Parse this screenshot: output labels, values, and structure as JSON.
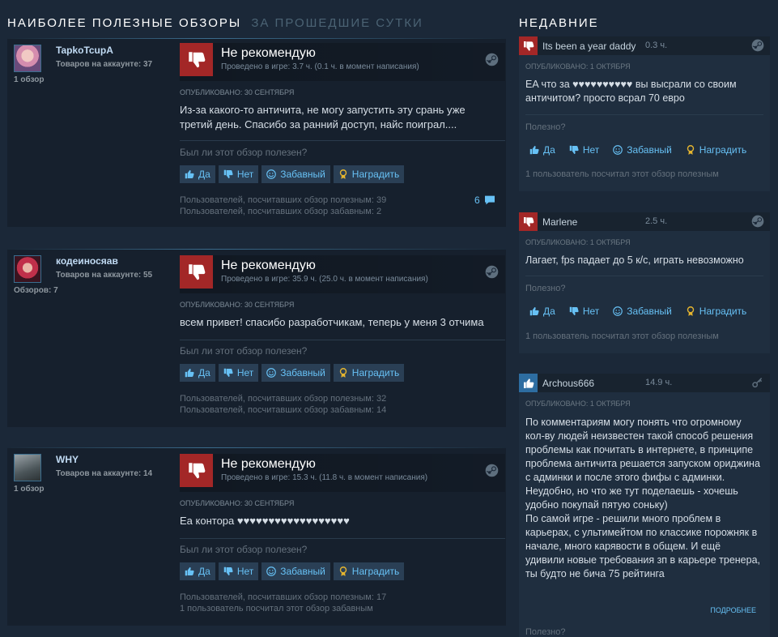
{
  "header": {
    "title": "Наиболее полезные обзоры",
    "subtitle": "за прошедшие сутки",
    "recent_title": "Недавние"
  },
  "colors": {
    "background": "#1b2838",
    "not_recommended": "#a32727",
    "recommended": "#2d6da1",
    "link": "#67c1f5"
  },
  "labels": {
    "helpful_question": "Был ли этот обзор полезен?",
    "helpful_short": "Полезно?",
    "yes": "Да",
    "no": "Нет",
    "funny": "Забавный",
    "award": "Наградить",
    "read_more": "подробнее"
  },
  "reviews": [
    {
      "author": "TapkoTcupA",
      "games": "Товаров на аккаунте: 37",
      "review_count": "1 обзор",
      "verdict": "Не рекомендую",
      "hours": "Проведено в игре: 3.7 ч. (0.1 ч. в момент написания)",
      "posted": "Опубликовано: 30 сентября",
      "text": "Из-за какого-то античита, не могу запустить эту срань уже третий день. Спасибо за ранний доступ, найс поиграл....",
      "stat1": "Пользователей, посчитавших обзор полезным: 39",
      "stat2": "Пользователей, посчитавших обзор забавным: 2",
      "comments": "6"
    },
    {
      "author": "кодеиносяав",
      "games": "Товаров на аккаунте: 55",
      "review_count": "Обзоров: 7",
      "verdict": "Не рекомендую",
      "hours": "Проведено в игре: 35.9 ч. (25.0 ч. в момент написания)",
      "posted": "Опубликовано: 30 сентября",
      "text": "всем привет! спасибо разработчикам, теперь у меня 3 отчима",
      "stat1": "Пользователей, посчитавших обзор полезным: 32",
      "stat2": "Пользователей, посчитавших обзор забавным: 14"
    },
    {
      "author": "WHY",
      "games": "Товаров на аккаунте: 14",
      "review_count": "1 обзор",
      "verdict": "Не рекомендую",
      "hours": "Проведено в игре: 15.3 ч. (11.8 ч. в момент написания)",
      "posted": "Опубликовано: 30 сентября",
      "text": "Ea контора ♥♥♥♥♥♥♥♥♥♥♥♥♥♥♥♥♥♥",
      "stat1": "Пользователей, посчитавших обзор полезным: 17",
      "stat2": "1 пользователь посчитал этот обзор забавным"
    }
  ],
  "recent": [
    {
      "author": "Its been a year daddy",
      "hours": "0.3 ч.",
      "posted": "Опубликовано: 1 октября",
      "text": "EA что за ♥♥♥♥♥♥♥♥♥♥ вы высрали со своим античитом? просто всрал 70 евро",
      "stat": "1 пользователь посчитал этот обзор полезным"
    },
    {
      "author": "Marlene",
      "hours": "2.5 ч.",
      "posted": "Опубликовано: 1 октября",
      "text": "Лагает, fps падает до 5 к/с, играть невозможно",
      "stat": "1 пользователь посчитал этот обзор полезным"
    },
    {
      "author": "Archous666",
      "hours": "14.9 ч.",
      "posted": "Опубликовано: 1 октября",
      "text": "По комментариям могу понять что огромному кол-ву людей неизвестен такой способ решения проблемы как почитать в интернете, в принципе проблема античита решается запуском ориджина с админки и после этого фифы с админки. Неудобно, но что же тут поделаешь - хочешь удобно покупай пятую соньку)\nПо самой игре - решили много проблем в карьерах, с ультимейтом по классике порожняк в начале, много карявости в общем. И ещё удивили новые требования зп в карьере тренера, ты будто не бича 75 рейтинга"
    }
  ]
}
